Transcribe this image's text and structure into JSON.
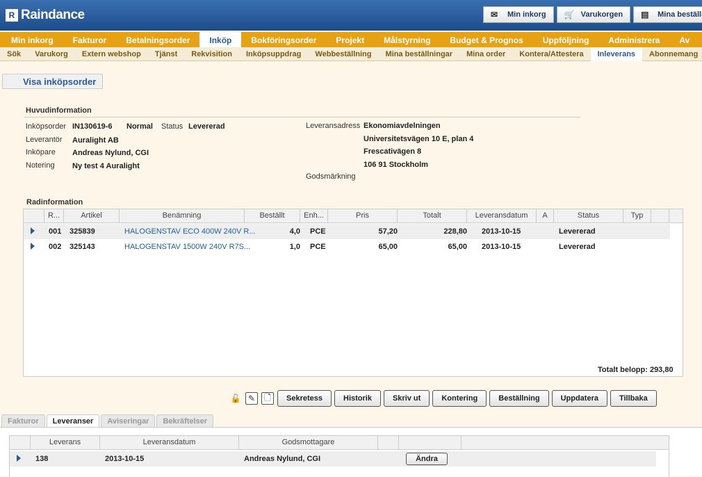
{
  "app": {
    "logo_mark": "R",
    "logo_text": "Raindance"
  },
  "quicklinks": [
    {
      "label": "Min inkorg",
      "icon": "inbox-icon"
    },
    {
      "label": "Varukorgen",
      "icon": "cart-icon"
    },
    {
      "label": "Mina beställningar",
      "icon": "orders-icon"
    }
  ],
  "main_nav": [
    {
      "label": "Min inkorg"
    },
    {
      "label": "Fakturor"
    },
    {
      "label": "Betalningsorder"
    },
    {
      "label": "Inköp",
      "active": true
    },
    {
      "label": "Bokföringsorder"
    },
    {
      "label": "Projekt"
    },
    {
      "label": "Målstyrning"
    },
    {
      "label": "Budget & Prognos"
    },
    {
      "label": "Uppföljning"
    },
    {
      "label": "Administrera"
    },
    {
      "label": "Av"
    }
  ],
  "sub_nav": [
    {
      "label": "Sök"
    },
    {
      "label": "Varukorg"
    },
    {
      "label": "Extern webshop"
    },
    {
      "label": "Tjänst"
    },
    {
      "label": "Rekvisition"
    },
    {
      "label": "Inköpsuppdrag"
    },
    {
      "label": "Webbeställning"
    },
    {
      "label": "Mina beställningar"
    },
    {
      "label": "Mina order"
    },
    {
      "label": "Kontera/Attestera"
    },
    {
      "label": "Inleverans",
      "active": true
    },
    {
      "label": "Abonnemang"
    },
    {
      "label": "F"
    }
  ],
  "page_title": "Visa inköpsorder",
  "header_info": {
    "section_title": "Huvudinformation",
    "order_label": "Inköpsorder",
    "order_value": "IN130619-6",
    "priority": "Normal",
    "status_label": "Status",
    "status_value": "Levererad",
    "supplier_label": "Leverantör",
    "supplier_value": "Auralight AB",
    "buyer_label": "Inköpare",
    "buyer_value": "Andreas Nylund, CGI",
    "note_label": "Notering",
    "note_value": "Ny test 4 Auralight",
    "delivery_address_label": "Leveransadress",
    "delivery_address_lines": [
      "Ekonomiavdelningen",
      "Universitetsvägen 10 E, plan 4",
      "Frescativägen 8",
      "106 91 Stockholm"
    ],
    "goods_marking_label": "Godsmärkning"
  },
  "rows_section": {
    "title": "Radinformation",
    "columns": [
      "R...",
      "Artikel",
      "Benämning",
      "Beställt",
      "Enh...",
      "Pris",
      "Totalt",
      "Leveransdatum",
      "A",
      "Status",
      "Typ"
    ],
    "rows": [
      {
        "row": "001",
        "article": "325839",
        "description": "HALOGENSTAV ECO 400W 240V R...",
        "ordered": "4,0",
        "unit": "PCE",
        "price": "57,20",
        "total": "228,80",
        "delivery_date": "2013-10-15",
        "a": "",
        "status": "Levererad",
        "type": ""
      },
      {
        "row": "002",
        "article": "325143",
        "description": "HALOGENSTAV 1500W 240V R7S...",
        "ordered": "1,0",
        "unit": "PCE",
        "price": "65,00",
        "total": "65,00",
        "delivery_date": "2013-10-15",
        "a": "",
        "status": "Levererad",
        "type": ""
      }
    ],
    "total_label": "Totalt belopp: 293,80"
  },
  "toolbar": {
    "icons": [
      {
        "name": "lock-icon",
        "glyph": "🔓"
      },
      {
        "name": "pencil-icon",
        "glyph": "✎"
      },
      {
        "name": "document-icon",
        "glyph": "🗋"
      }
    ],
    "buttons": [
      "Sekretess",
      "Historik",
      "Skriv ut",
      "Kontering",
      "Beställning",
      "Uppdatera",
      "Tillbaka"
    ]
  },
  "bottom_tabs": [
    {
      "label": "Fakturor"
    },
    {
      "label": "Leveranser",
      "active": true
    },
    {
      "label": "Aviseringar"
    },
    {
      "label": "Bekräftelser"
    }
  ],
  "deliveries": {
    "columns": [
      "Leverans",
      "Leveransdatum",
      "Godsmottagare"
    ],
    "rows": [
      {
        "delivery": "138",
        "date": "2013-10-15",
        "receiver": "Andreas Nylund, CGI",
        "action": "Ändra"
      }
    ]
  }
}
